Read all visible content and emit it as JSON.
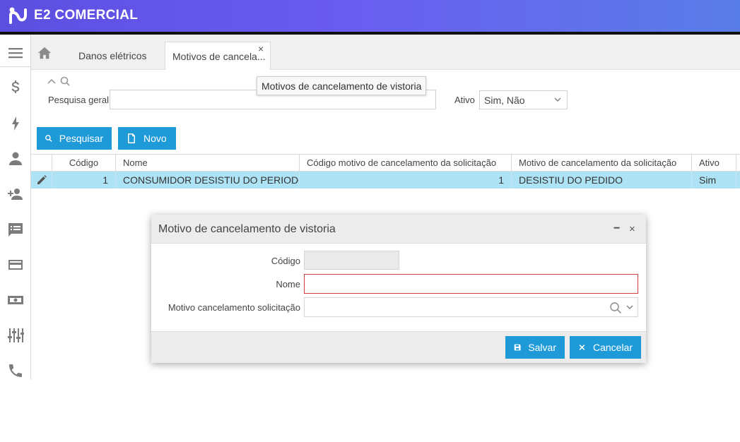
{
  "app": {
    "name": "E2 COMERCIAL"
  },
  "tabs": [
    {
      "label": "Danos elétricos"
    },
    {
      "label": "Motivos de cancela...",
      "close": "×"
    }
  ],
  "tooltip": {
    "text": "Motivos de cancelamento de vistoria"
  },
  "filters": {
    "general_search_label": "Pesquisa geral",
    "general_search_value": "",
    "active_label": "Ativo",
    "active_value": "Sim, Não"
  },
  "buttons": {
    "search": "Pesquisar",
    "new": "Novo"
  },
  "grid": {
    "columns": [
      "Código",
      "Nome",
      "Código motivo de cancelamento da solicitação",
      "Motivo de cancelamento da solicitação",
      "Ativo"
    ],
    "rows": [
      {
        "codigo": "1",
        "nome": "CONSUMIDOR DESISTIU DO PERIODO",
        "codigo_motivo": "1",
        "motivo": "DESISTIU DO PEDIDO",
        "ativo": "Sim"
      }
    ]
  },
  "dialog": {
    "title": "Motivo de cancelamento de vistoria",
    "minimize": "−",
    "close": "×",
    "fields": {
      "codigo_label": "Código",
      "codigo_value": "",
      "nome_label": "Nome",
      "nome_value": "",
      "motivo_label": "Motivo cancelamento solicitação",
      "motivo_value": ""
    },
    "save_label": "Salvar",
    "cancel_label": "Cancelar"
  },
  "colors": {
    "header_start": "#5b4fe0",
    "header_end": "#5a7ee8",
    "primary_button": "#1f9ad8",
    "selected_row": "#aee3f5",
    "required_border": "#d23c3c"
  },
  "icons": [
    "menu-icon",
    "dollar-icon",
    "lightning-icon",
    "person-icon",
    "add-person-icon",
    "chat-list-icon",
    "card-icon",
    "money-icon",
    "sliders-icon",
    "phone-icon",
    "home-icon",
    "search-icon",
    "document-icon",
    "pencil-icon",
    "save-icon"
  ]
}
